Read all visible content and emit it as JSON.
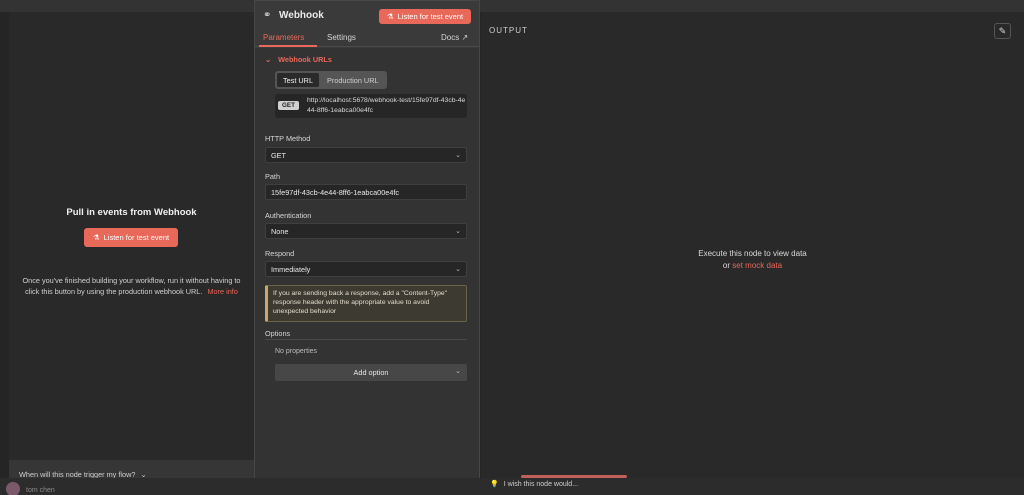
{
  "input_panel": {
    "title": "Pull in events from Webhook",
    "listen_button": "Listen for test event",
    "help_text": "Once you've finished building your workflow, run it without having to click this button by using the production webhook URL.",
    "more_info": "More info",
    "footer_question": "When will this node trigger my flow?"
  },
  "node": {
    "title": "Webhook",
    "listen_button": "Listen for test event",
    "tabs": {
      "parameters": "Parameters",
      "settings": "Settings",
      "docs": "Docs"
    },
    "webhook_urls": {
      "section_label": "Webhook URLs",
      "test_url_label": "Test URL",
      "production_url_label": "Production URL",
      "method_badge": "GET",
      "url": "http://localhost:5678/webhook-test/15fe97df-43cb-4e44-8ff6-1eabca00e4fc"
    },
    "http_method": {
      "label": "HTTP Method",
      "value": "GET"
    },
    "path": {
      "label": "Path",
      "value": "15fe97df-43cb-4e44-8ff6-1eabca00e4fc"
    },
    "authentication": {
      "label": "Authentication",
      "value": "None"
    },
    "respond": {
      "label": "Respond",
      "value": "Immediately"
    },
    "notice": "If you are sending back a response, add a \"Content-Type\" response header with the appropriate value to avoid unexpected behavior",
    "options": {
      "label": "Options",
      "empty_text": "No properties",
      "add_button": "Add option"
    }
  },
  "output_panel": {
    "title": "OUTPUT",
    "empty_line1": "Execute this node to view data",
    "empty_or": "or",
    "mock_link": "set mock data"
  },
  "footer": {
    "feedback": "I wish this node would...",
    "user_name": "tom chen"
  },
  "icons": {
    "node": "webhook-icon",
    "listen": "flask-icon",
    "external": "external-link-icon",
    "chevron": "chevron-down-icon",
    "edit": "pencil-icon",
    "feedback": "lightbulb-icon"
  },
  "colors": {
    "accent": "#e8685a",
    "background": "#252525",
    "panel": "#3a3a3a",
    "warning_border": "#c8a96a"
  }
}
